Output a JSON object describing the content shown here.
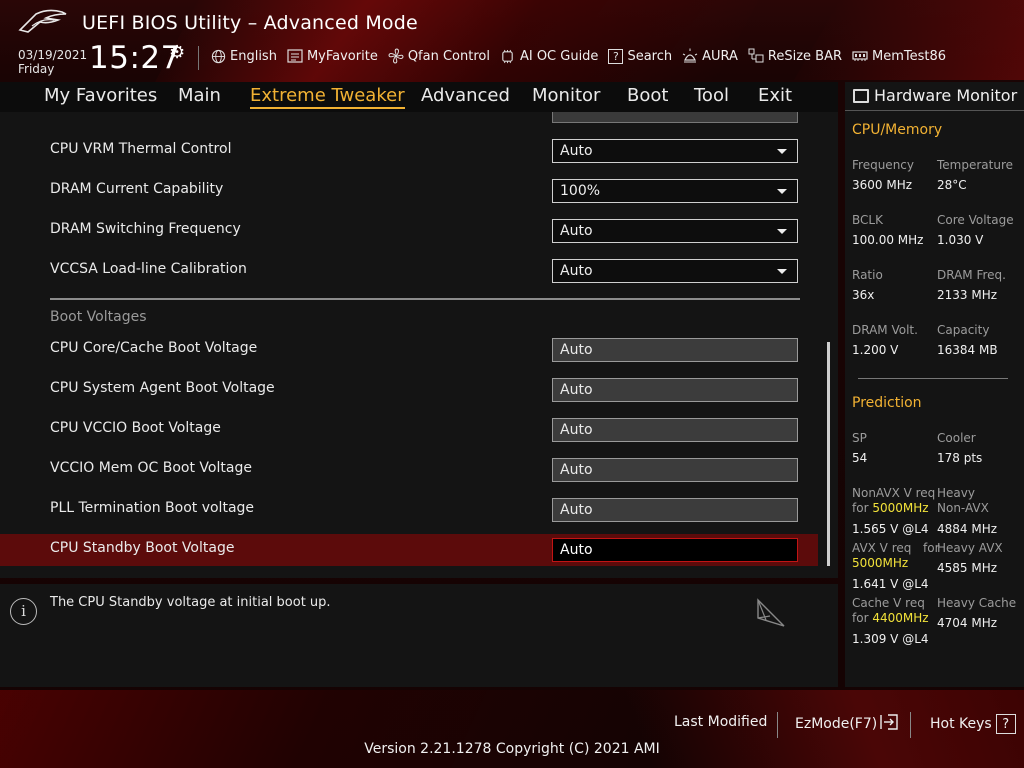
{
  "header": {
    "app_title": "UEFI BIOS Utility – Advanced Mode",
    "date": "03/19/2021",
    "day": "Friday",
    "time": "15:27"
  },
  "toolbar": [
    {
      "label": "English",
      "icon": "globe-icon"
    },
    {
      "label": "MyFavorite",
      "icon": "favorite-list-icon"
    },
    {
      "label": "Qfan Control",
      "icon": "fan-icon"
    },
    {
      "label": "AI OC Guide",
      "icon": "ai-chip-icon"
    },
    {
      "label": "Search",
      "icon": "search-help-icon"
    },
    {
      "label": "AURA",
      "icon": "aura-light-icon"
    },
    {
      "label": "ReSize BAR",
      "icon": "resize-bar-icon"
    },
    {
      "label": "MemTest86",
      "icon": "memory-icon"
    }
  ],
  "menu": {
    "items": [
      "My Favorites",
      "Main",
      "Extreme Tweaker",
      "Advanced",
      "Monitor",
      "Boot",
      "Tool",
      "Exit"
    ],
    "active": "Extreme Tweaker"
  },
  "settings": {
    "dropdowns": [
      {
        "label": "CPU VRM Thermal Control",
        "value": "Auto"
      },
      {
        "label": "DRAM Current Capability",
        "value": "100%"
      },
      {
        "label": "DRAM Switching Frequency",
        "value": "Auto"
      },
      {
        "label": "VCCSA Load-line Calibration",
        "value": "Auto"
      }
    ],
    "section_title": "Boot Voltages",
    "fields": [
      {
        "label": "CPU Core/Cache Boot Voltage",
        "value": "Auto"
      },
      {
        "label": "CPU System Agent Boot Voltage",
        "value": "Auto"
      },
      {
        "label": "CPU VCCIO Boot Voltage",
        "value": "Auto"
      },
      {
        "label": "VCCIO Mem OC Boot Voltage",
        "value": "Auto"
      },
      {
        "label": "PLL Termination Boot voltage",
        "value": "Auto"
      },
      {
        "label": "CPU Standby Boot Voltage",
        "value": "Auto"
      }
    ]
  },
  "help_text": "The CPU Standby voltage at initial boot up.",
  "hardware_monitor": {
    "title": "Hardware Monitor",
    "cpu_memory_title": "CPU/Memory",
    "frequency_label": "Frequency",
    "frequency": "3600 MHz",
    "temperature_label": "Temperature",
    "temperature": "28°C",
    "bclk_label": "BCLK",
    "bclk": "100.00 MHz",
    "core_voltage_label": "Core Voltage",
    "core_voltage": "1.030 V",
    "ratio_label": "Ratio",
    "ratio": "36x",
    "dram_freq_label": "DRAM Freq.",
    "dram_freq": "2133 MHz",
    "dram_volt_label": "DRAM Volt.",
    "dram_volt": "1.200 V",
    "capacity_label": "Capacity",
    "capacity": "16384 MB",
    "prediction_title": "Prediction",
    "sp_label": "SP",
    "sp": "54",
    "cooler_label": "Cooler",
    "cooler": "178 pts",
    "nonavx_label_a": "NonAVX V req",
    "nonavx_label_for": "for",
    "nonavx_freq": "5000MHz",
    "nonavx_value": "1.565 V @L4",
    "heavy_nonavx_label_a": "Heavy",
    "heavy_nonavx_label_b": "Non-AVX",
    "heavy_nonavx_value": "4884 MHz",
    "avx_label_a": "AVX V req",
    "avx_label_for": "for",
    "avx_freq": "5000MHz",
    "avx_value": "1.641 V @L4",
    "heavy_avx_label": "Heavy AVX",
    "heavy_avx_value": "4585 MHz",
    "cache_label_a": "Cache V req",
    "cache_label_for": "for",
    "cache_freq": "4400MHz",
    "cache_value": "1.309 V @L4",
    "heavy_cache_label": "Heavy Cache",
    "heavy_cache_value": "4704 MHz"
  },
  "footer": {
    "last_modified": "Last Modified",
    "ezmode": "EzMode(F7)",
    "hotkeys": "Hot Keys",
    "hotkeys_key": "?",
    "version": "Version 2.21.1278 Copyright (C) 2021 AMI"
  },
  "colors": {
    "accent": "#f2b233",
    "selected_row": "#5c0b0b",
    "highlight_freq": "#f2e23a"
  }
}
